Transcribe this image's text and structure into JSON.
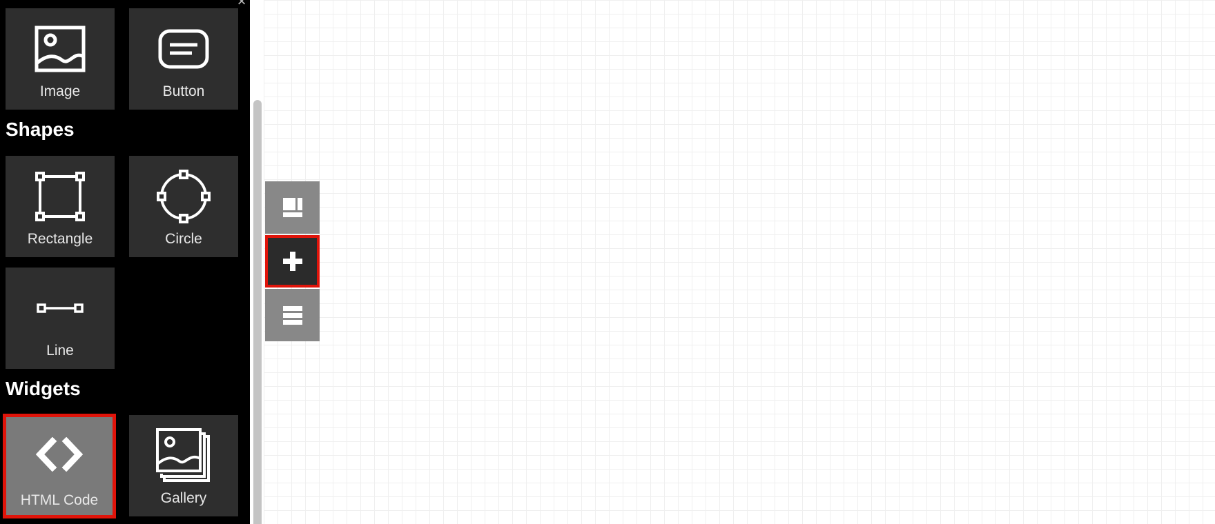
{
  "panel": {
    "sections": [
      {
        "title": ""
      },
      {
        "title": "Shapes"
      },
      {
        "title": "Widgets"
      }
    ],
    "items": {
      "image": {
        "label": "Image",
        "icon": "image-icon"
      },
      "button": {
        "label": "Button",
        "icon": "button-icon"
      },
      "rectangle": {
        "label": "Rectangle",
        "icon": "rectangle-icon"
      },
      "circle": {
        "label": "Circle",
        "icon": "circle-icon"
      },
      "line": {
        "label": "Line",
        "icon": "line-icon"
      },
      "html_code": {
        "label": "HTML Code",
        "icon": "code-icon",
        "selected": true
      },
      "gallery": {
        "label": "Gallery",
        "icon": "gallery-icon"
      }
    },
    "close_icon": "close-icon"
  },
  "toolbar": {
    "buttons": [
      {
        "name": "layout-icon",
        "active": false
      },
      {
        "name": "plus-icon",
        "active": true
      },
      {
        "name": "layers-icon",
        "active": false
      }
    ]
  },
  "colors": {
    "panel_bg": "#000000",
    "tile_bg": "#2e2e2e",
    "selected_tile_bg": "#7a7a7a",
    "highlight": "#e0140a",
    "toolbar_bg": "#888888",
    "toolbar_active_bg": "#2b2b2b",
    "grid_line": "#efefef"
  }
}
